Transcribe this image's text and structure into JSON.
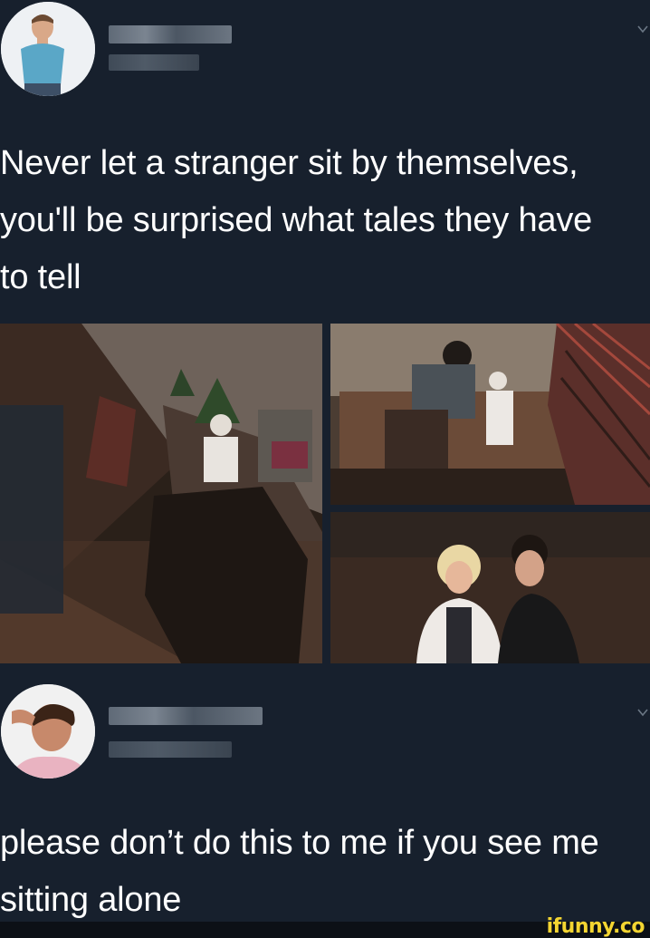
{
  "tweet1": {
    "text": "Never let a stranger sit by themselves,\nyou'll be surprised what tales they have\nto tell"
  },
  "tweet2": {
    "text": "please don’t do this to me if you see me\nsitting alone"
  },
  "watermark": "ifunny.co",
  "colors": {
    "background": "#17202d",
    "text": "#ffffff",
    "watermark": "#f4d531"
  },
  "icons": {
    "menu": "chevron-down-icon",
    "avatar": "profile-avatar"
  }
}
